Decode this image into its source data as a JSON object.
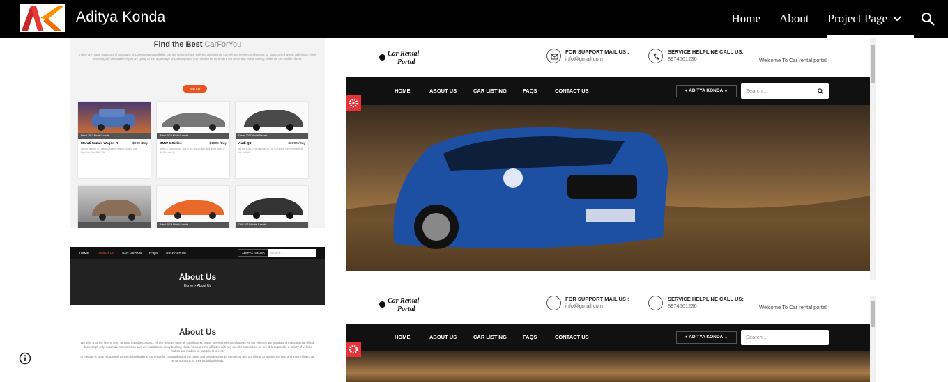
{
  "site": {
    "title": "Aditya Konda",
    "nav": [
      {
        "label": "Home"
      },
      {
        "label": "About"
      },
      {
        "label": "Project Page"
      }
    ]
  },
  "listing": {
    "heading_bold": "Find the Best",
    "heading_light": "CarForYou",
    "intro": "There are many variations of passages of Lorem Ipsum available, but the majority have suffered alteration in some form, by injected humour, or randomised words which don't look even slightly believable. If you are going to use a passage of Lorem Ipsum, you need to be sure there isn't anything embarrassing hidden in the middle of text.",
    "pill": "New Car",
    "cards": [
      {
        "bar": "Petrol   2017 Model   5 seats",
        "name": "Maruti Suzuki Wagon R",
        "price": "$900 /Day",
        "desc": "Maruti Wagon R Latest Updates Maruti Suzuki has launched the BS6 Wa"
      },
      {
        "bar": "Petrol   2019 Model   5 seats",
        "name": "BMW 5 Series",
        "price": "$1000 /Day",
        "desc": "BMW 5 Series price starts at ? 55.4 Lakh and goes upto ? 68.39 Lakh (e"
      },
      {
        "bar": "Diesel   2017 Model   5 seats",
        "name": "Audi Q8",
        "price": "$2000 /Day",
        "desc": "As per ARAI, the mileage of Q8 is 0 kmpl. Real mileage of the vehicle"
      },
      {
        "bar": "",
        "name": "",
        "price": "",
        "desc": ""
      },
      {
        "bar": "Petrol   2019 Model   5 seats",
        "name": "",
        "price": "",
        "desc": ""
      },
      {
        "bar": "CNG   2018 Model   5 seats",
        "name": "",
        "price": "",
        "desc": ""
      }
    ]
  },
  "about_tile": {
    "nav": [
      "HOME",
      "ABOUT US",
      "CAR LISTING",
      "FAQS",
      "CONTACT US"
    ],
    "user": "ADITYA KONDA",
    "search": "Search...",
    "title": "About Us",
    "breadcrumb": "Home  >  About Us"
  },
  "about_text": {
    "title": "About Us",
    "p1": "We offer a varied fleet of cars, ranging from the compact. All our vehicles have air conditioning, power steering, electric windows. All our vehicles are bought and maintained at official dealerships only. Automatic transmission cars are available in every booking class. As we are not affiliated with any specific automaker, we are able to provide a variety of vehicle makes and models for customers to rent.",
    "p2": "ur mission is to be recognised as the global leader in car rental for companies and the public and private sector by partnering with our clients to provide the best and most efficient car rental solutions for their individual needs."
  },
  "portal": {
    "brand_line1": "Car Rental",
    "brand_line2": "Portal",
    "support_label": "FOR SUPPORT MAIL US :",
    "support_value": "info@gmail.com",
    "helpline_label": "SERVICE HELPLINE CALL US:",
    "helpline_value": "8974561236",
    "welcome": "Welcome To Car rental portal",
    "nav": [
      "HOME",
      "ABOUT US",
      "CAR LISTING",
      "FAQS",
      "CONTACT US"
    ],
    "user": "ADITYA KONDA",
    "search_placeholder": "Search..."
  },
  "icons": [
    "logo-ak",
    "chevron-down-icon",
    "search-icon",
    "info-icon",
    "mail-icon",
    "phone-icon",
    "user-icon",
    "gear-icon"
  ]
}
